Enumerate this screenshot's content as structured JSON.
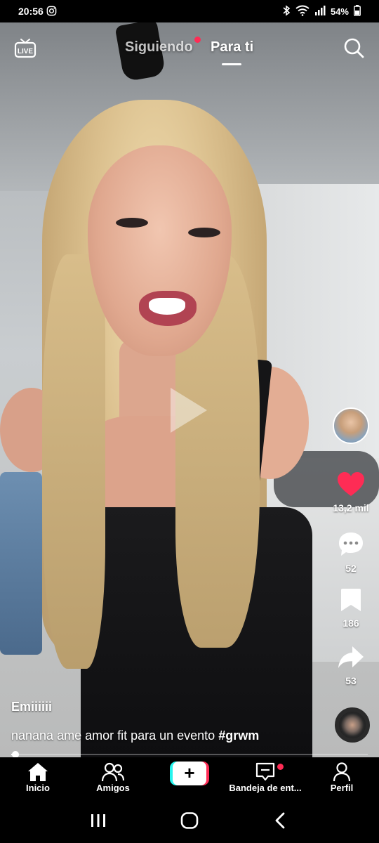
{
  "status_bar": {
    "time": "20:56",
    "battery": "54%",
    "icons": [
      "instagram-icon",
      "bluetooth-icon",
      "wifi-icon",
      "signal-icon",
      "battery-icon"
    ]
  },
  "top_nav": {
    "tabs": [
      {
        "label": "Siguiendo",
        "active": false,
        "has_notification_dot": true
      },
      {
        "label": "Para ti",
        "active": true
      }
    ],
    "live_icon_text": "LIVE"
  },
  "actions": {
    "likes": "13,2 mil",
    "comments": "52",
    "saves": "186",
    "shares": "53"
  },
  "video": {
    "username": "Emiiiiii",
    "caption_text": "nanana ame amor fit para un evento ",
    "caption_hashtag": "#grwm",
    "progress": 0.01
  },
  "bottom_nav": {
    "items": [
      {
        "label": "Inicio",
        "icon": "home-icon",
        "active": true
      },
      {
        "label": "Amigos",
        "icon": "friends-icon"
      },
      {
        "label": "",
        "icon": "create-plus-icon"
      },
      {
        "label": "Bandeja de ent...",
        "icon": "inbox-icon",
        "has_notification_dot": true
      },
      {
        "label": "Perfil",
        "icon": "profile-icon"
      }
    ]
  },
  "colors": {
    "accent_red": "#fe2c55",
    "accent_cyan": "#25f4ee",
    "like_heart": "#fe2c55"
  }
}
